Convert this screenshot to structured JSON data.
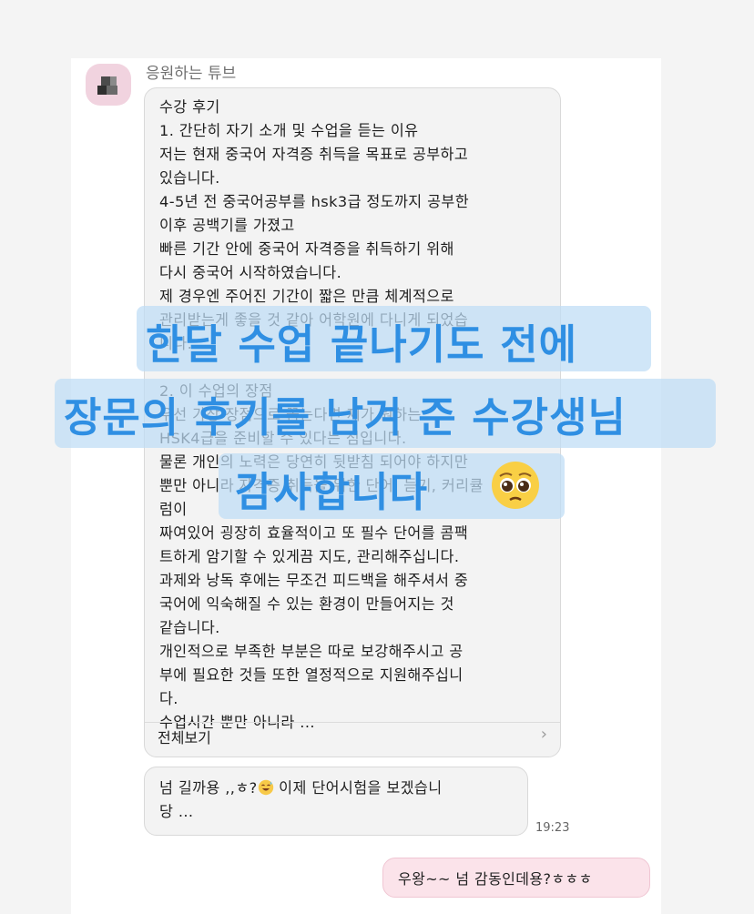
{
  "sender": {
    "name": "응원하는 튜브"
  },
  "review_message": {
    "lines": [
      "수강 후기",
      "1. 간단히 자기 소개 및 수업을 듣는 이유",
      "저는 현재 중국어 자격증 취득을 목표로 공부하고",
      "있습니다.",
      "4-5년 전 중국어공부를 hsk3급 정도까지 공부한",
      "이후 공백기를 가졌고",
      "빠른 기간 안에 중국어 자격증을 취득하기 위해",
      "다시 중국어 시작하였습니다.",
      "제 경우엔 주어진 기간이 짧은 만큼 체계적으로",
      "관리받는게 좋을 것 같아 어학원에 다니게 되었습",
      "니다.",
      "",
      "2. 이 수업의 장점",
      "우선 가장 장점으로 꼽는다면 제가 원하는",
      "HSK4급을 준비할 수 있다는 점입니다.",
      "물론 개인의 노력은 당연히 뒷받침 되어야 하지만",
      "뿐만 아니라 자격증 취득을 위한 단어, 듣기, 커리큘",
      "럼이",
      "짜여있어 굉장히 효율적이고 또 필수 단어를 콤팩",
      "트하게 암기할 수 있게끔 지도, 관리해주십니다.",
      "과제와 낭독 후에는 무조건 피드백을 해주셔서 중",
      "국어에 익숙해질 수 있는 환경이 만들어지는 것",
      "같습니다.",
      "개인적으로 부족한 부분은 따로 보강해주시고 공",
      "부에 필요한 것들 또한 열정적으로 지원해주십니",
      "다.",
      "수업시간 뿐만 아니라 ..."
    ],
    "view_all_label": "전체보기"
  },
  "reply_message": {
    "text_before_emoji": "넘 길까용 ,,ㅎ?",
    "emoji_name": "sweat-smile-emoji",
    "text_after_emoji": " 이제 단어시험을 보겠습니",
    "line2": "당 ...",
    "time": "19:23"
  },
  "sent_message": {
    "text": "우왕~~ 넘 감동인데용?ㅎㅎㅎ"
  },
  "overlay_caption": {
    "line1": "한달 수업 끝나기도 전에",
    "line2": "장문의 후기를 남겨 준 수강생님",
    "line3": "감사합니다",
    "emoji_name": "pleading-face-emoji"
  },
  "colors": {
    "caption_text": "#2f8fe3",
    "caption_band": "#bedcf5",
    "bubble_bg": "#f3f3f3",
    "sent_bubble_bg": "#fbe3ea"
  }
}
